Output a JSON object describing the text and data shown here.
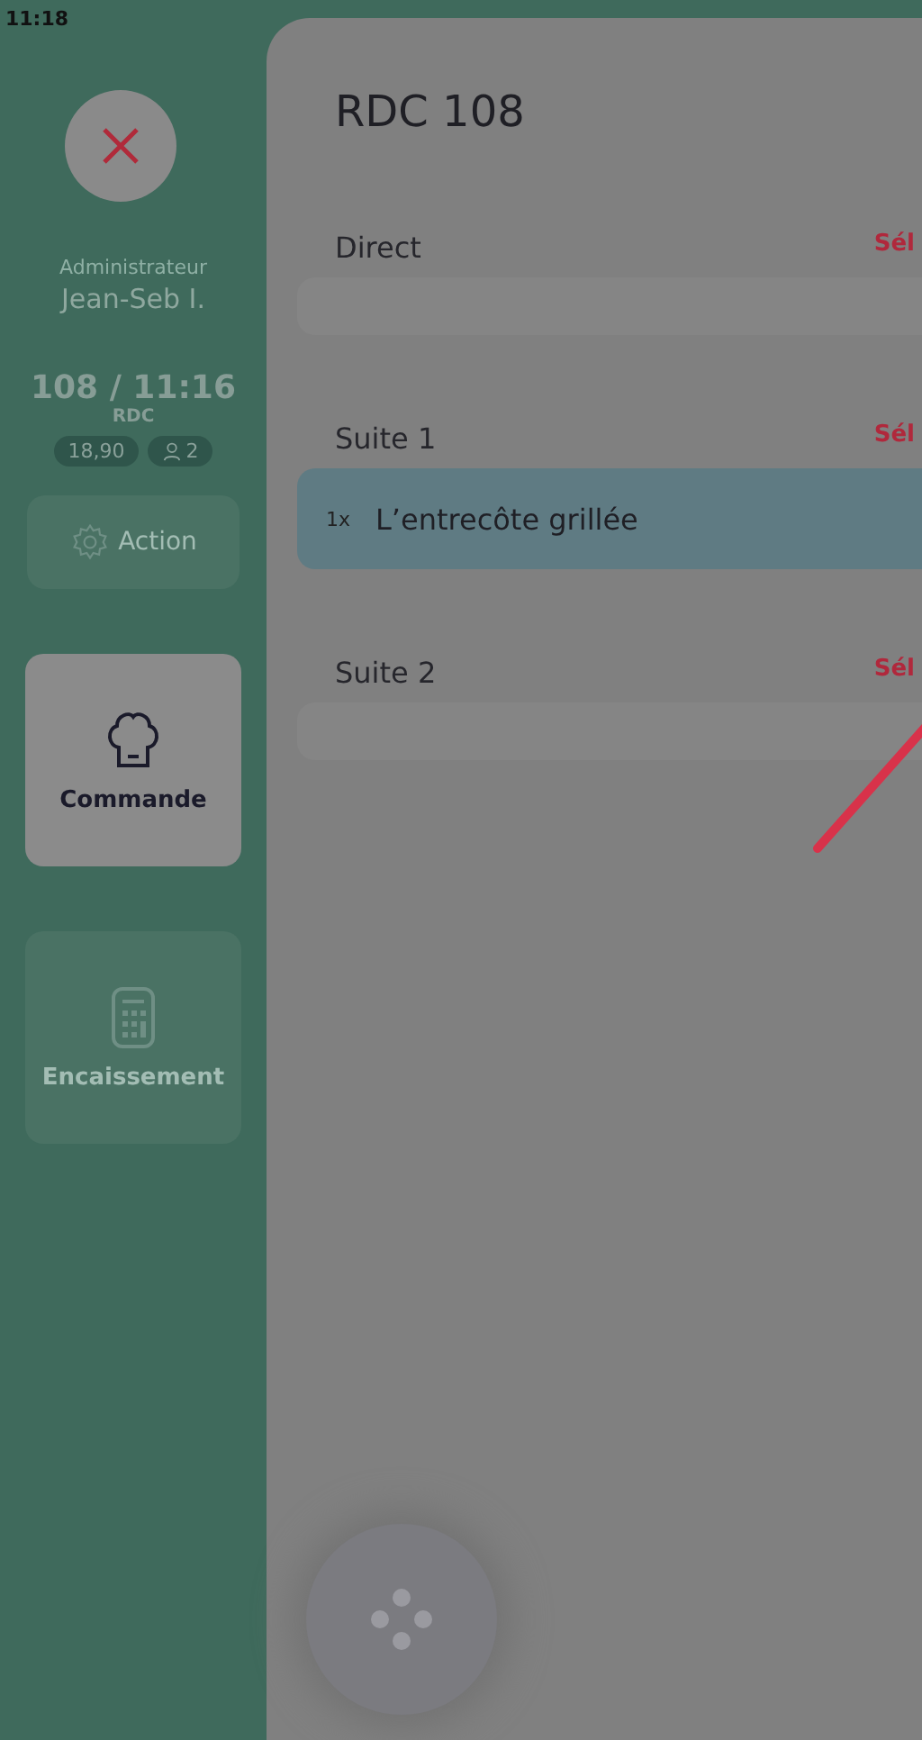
{
  "status_bar": {
    "time": "11:18"
  },
  "sidebar": {
    "role": "Administrateur",
    "user": "Jean-Seb I.",
    "table": "108 / 11:16",
    "area": "RDC",
    "amount": "18,90",
    "guests": "2",
    "action": "Action",
    "nav": [
      {
        "label": "Commande",
        "kind": "chef",
        "selected": true
      },
      {
        "label": "Encaissement",
        "kind": "calculator",
        "selected": false
      }
    ]
  },
  "panel": {
    "title": "RDC 108",
    "sections": [
      {
        "name": "Direct",
        "select": "Sél"
      },
      {
        "name": "Suite 1",
        "select": "Sél",
        "items": [
          {
            "qty": "1x",
            "name": "L’entrecôte grillée",
            "selected": true
          }
        ]
      },
      {
        "name": "Suite 2",
        "select": "Sél"
      }
    ]
  }
}
